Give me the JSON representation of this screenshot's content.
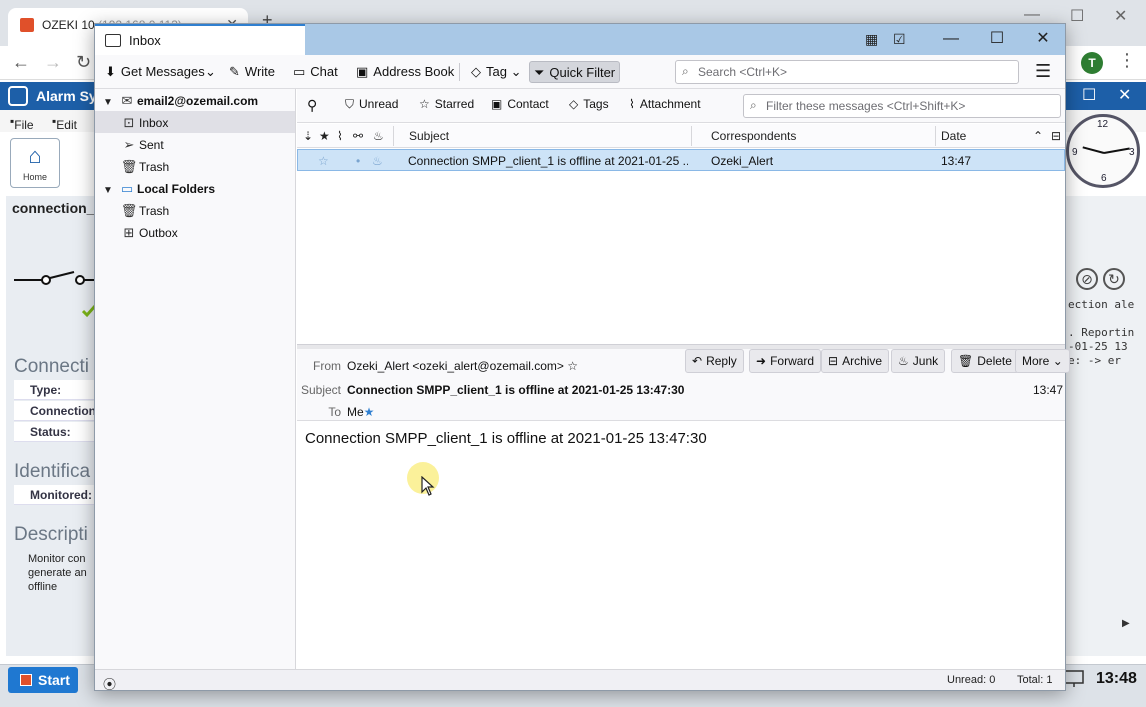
{
  "background": {
    "browser_tab_title": "OZEKI 10",
    "browser_tab_ip": "(192.168.0.113)",
    "avatar_letter": "T",
    "app_title": "Alarm Sy",
    "menu": {
      "file": "File",
      "edit": "Edit"
    },
    "home_label": "Home",
    "connection_title": "connection_",
    "section_connection": "Connecti",
    "section_identification": "Identifica",
    "section_description": "Descripti",
    "rows": {
      "type": "Type:",
      "connection": "Connection",
      "status": "Status:",
      "monitored": "Monitored:"
    },
    "description_text": "Monitor con generate an offline",
    "right_log": [
      "ection ale",
      ". Reportin",
      "-01-25 13",
      "e:  -> er"
    ],
    "taskbar": {
      "start": "Start",
      "time": "13:48"
    }
  },
  "thunderbird": {
    "tab_title": "Inbox",
    "toolbar": {
      "get_messages": "Get Messages",
      "write": "Write",
      "chat": "Chat",
      "address_book": "Address Book",
      "tag": "Tag",
      "quick_filter": "Quick Filter",
      "search_placeholder": "Search <Ctrl+K>"
    },
    "folders": {
      "account": "email2@ozemail.com",
      "inbox": "Inbox",
      "sent": "Sent",
      "trash": "Trash",
      "local_folders": "Local Folders",
      "local_trash": "Trash",
      "outbox": "Outbox"
    },
    "quick_filter_bar": {
      "unread": "Unread",
      "starred": "Starred",
      "contact": "Contact",
      "tags": "Tags",
      "attachment": "Attachment",
      "filter_placeholder": "Filter these messages <Ctrl+Shift+K>"
    },
    "thread_columns": {
      "subject": "Subject",
      "correspondents": "Correspondents",
      "date": "Date"
    },
    "messages": [
      {
        "subject": "Connection SMPP_client_1 is offline at 2021-01-25 ...",
        "correspondent": "Ozeki_Alert",
        "date": "13:47"
      }
    ],
    "message_header": {
      "from_label": "From",
      "from_value": "Ozeki_Alert <ozeki_alert@ozemail.com>",
      "subject_label": "Subject",
      "subject_value": "Connection SMPP_client_1 is offline at 2021-01-25 13:47:30",
      "to_label": "To",
      "to_value": "Me",
      "time": "13:47",
      "buttons": {
        "reply": "Reply",
        "forward": "Forward",
        "archive": "Archive",
        "junk": "Junk",
        "delete": "Delete",
        "more": "More"
      }
    },
    "message_body": "Connection SMPP_client_1 is offline at 2021-01-25 13:47:30",
    "status_bar": {
      "unread": "Unread: 0",
      "total": "Total: 1"
    }
  },
  "colors": {
    "selection": "#cde3f7",
    "accent": "#2f7fd0",
    "title_bar": "#a9c8e6",
    "app_header": "#1d5fa8"
  }
}
